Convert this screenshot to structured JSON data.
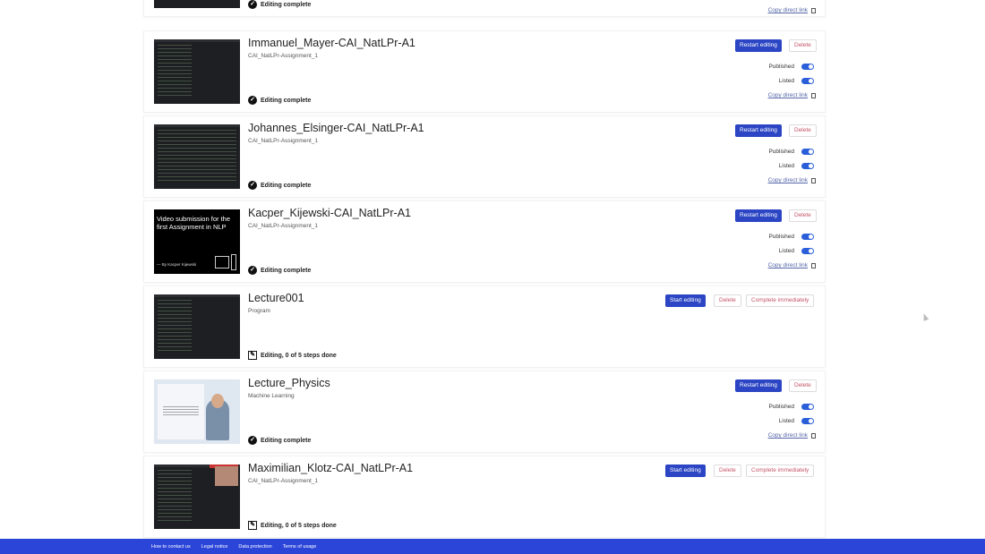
{
  "videos": [
    {
      "title": "",
      "subtitle": "",
      "status": "Editing complete",
      "copy_link": "Copy direct link"
    },
    {
      "title": "Immanuel_Mayer-CAI_NatLPr-A1",
      "subtitle": "CAI_NatLPr-Assignment_1",
      "status": "Editing complete",
      "primary_button": "Restart editing",
      "delete_button": "Delete",
      "published_label": "Published",
      "listed_label": "Listed",
      "copy_link": "Copy direct link"
    },
    {
      "title": "Johannes_Elsinger-CAI_NatLPr-A1",
      "subtitle": "CAI_NatLPr-Assignment_1",
      "status": "Editing complete",
      "primary_button": "Restart editing",
      "delete_button": "Delete",
      "published_label": "Published",
      "listed_label": "Listed",
      "copy_link": "Copy direct link"
    },
    {
      "title": "Kacper_Kijewski-CAI_NatLPr-A1",
      "subtitle": "CAI_NatLPr-Assignment_1",
      "status": "Editing complete",
      "primary_button": "Restart editing",
      "delete_button": "Delete",
      "published_label": "Published",
      "listed_label": "Listed",
      "copy_link": "Copy direct link",
      "thumb_text": "Video submission for the first Assignment in NLP",
      "thumb_by": "— By Kacper Kijewski"
    },
    {
      "title": "Lecture001",
      "subtitle": "Program",
      "status": "Editing, 0 of 5 steps done",
      "primary_button": "Start editing",
      "delete_button": "Delete",
      "complete_button": "Complete immediately"
    },
    {
      "title": "Lecture_Physics",
      "subtitle": "Machine Learning",
      "status": "Editing complete",
      "primary_button": "Restart editing",
      "delete_button": "Delete",
      "published_label": "Published",
      "listed_label": "Listed",
      "copy_link": "Copy direct link"
    },
    {
      "title": "Maximilian_Klotz-CAI_NatLPr-A1",
      "subtitle": "CAI_NatLPr-Assignment_1",
      "status": "Editing, 0 of 5 steps done",
      "primary_button": "Start editing",
      "delete_button": "Delete",
      "complete_button": "Complete immediately"
    }
  ],
  "footer": {
    "contact": "How to contact us",
    "legal": "Legal notice",
    "privacy": "Data protection",
    "terms": "Terms of usage"
  },
  "colors": {
    "primary": "#2b45c4",
    "footer": "#2b45d9",
    "delete_text": "#c5566a",
    "toggle_on": "#2b5fd9"
  }
}
